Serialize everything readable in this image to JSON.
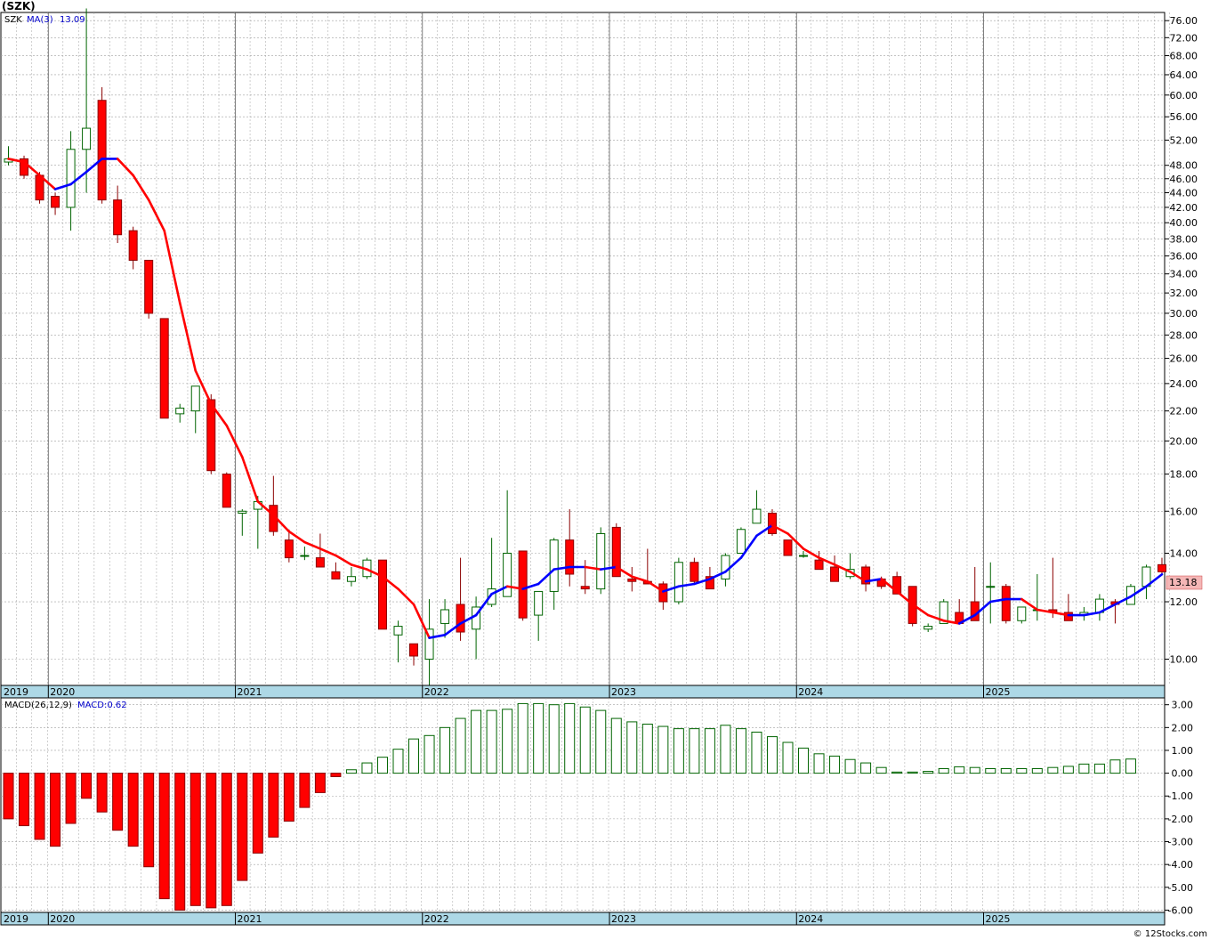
{
  "header": {
    "title": "(SZK)"
  },
  "price_panel": {
    "legend_symbol": "SZK",
    "legend_ma": "MA(3)",
    "legend_ma_value": "13.09",
    "current_price_label": "13.18"
  },
  "macd_panel": {
    "legend_name": "MACD(26,12,9)",
    "legend_value": "MACD:0.62"
  },
  "watermark": "© 12Stocks.com",
  "colors": {
    "up_fill": "#ffffff",
    "up_stroke": "#006400",
    "down_fill": "#ff0000",
    "down_stroke": "#8b0000",
    "ma_down": "#ff0000",
    "ma_up": "#0000ff",
    "axis_band": "#add8e6",
    "grid": "#a0a0a0",
    "price_tag_bg": "#f4b6b6"
  },
  "chart_data": [
    {
      "type": "candlestick",
      "scale": "log",
      "interval": "monthly",
      "ylim": [
        9.2,
        78
      ],
      "y_ticks": [
        "10.00",
        "12.00",
        "14.00",
        "16.00",
        "18.00",
        "20.00",
        "22.00",
        "24.00",
        "26.00",
        "28.00",
        "30.00",
        "32.00",
        "34.00",
        "36.00",
        "38.00",
        "40.00",
        "42.00",
        "44.00",
        "46.00",
        "48.00",
        "52.00",
        "56.00",
        "60.00",
        "64.00",
        "68.00",
        "72.00",
        "76.00"
      ],
      "x_labels": [
        "2019",
        "2020",
        "2021",
        "2022",
        "2023",
        "2024",
        "2025"
      ],
      "ohlc": [
        [
          48.5,
          51.0,
          48.0,
          49.0
        ],
        [
          49.0,
          49.5,
          46.0,
          46.5
        ],
        [
          46.5,
          47.0,
          42.5,
          43.0
        ],
        [
          43.5,
          44.0,
          41.0,
          42.0
        ],
        [
          42.0,
          53.5,
          39.0,
          50.5
        ],
        [
          50.5,
          79.0,
          44.0,
          54.0
        ],
        [
          59.0,
          61.5,
          42.5,
          43.0
        ],
        [
          43.0,
          45.0,
          37.5,
          38.5
        ],
        [
          39.0,
          39.5,
          34.5,
          35.5
        ],
        [
          35.5,
          35.5,
          29.5,
          30.0
        ],
        [
          29.5,
          29.5,
          21.5,
          21.5
        ],
        [
          21.8,
          22.5,
          21.2,
          22.2
        ],
        [
          22.0,
          23.8,
          20.5,
          23.8
        ],
        [
          22.8,
          23.2,
          18.0,
          18.2
        ],
        [
          18.0,
          18.1,
          16.2,
          16.2
        ],
        [
          15.9,
          16.1,
          14.8,
          16.0
        ],
        [
          16.1,
          16.8,
          14.2,
          16.5
        ],
        [
          16.3,
          17.9,
          14.8,
          15.0
        ],
        [
          14.6,
          15.1,
          13.6,
          13.8
        ],
        [
          13.9,
          14.3,
          13.7,
          13.9
        ],
        [
          13.8,
          14.9,
          13.4,
          13.4
        ],
        [
          13.2,
          13.6,
          12.9,
          12.9
        ],
        [
          12.8,
          13.4,
          12.6,
          13.0
        ],
        [
          13.0,
          13.8,
          12.9,
          13.7
        ],
        [
          13.7,
          13.7,
          11.0,
          11.0
        ],
        [
          10.8,
          11.3,
          9.9,
          11.1
        ],
        [
          10.5,
          10.5,
          9.8,
          10.1
        ],
        [
          10.0,
          12.1,
          9.2,
          11.0
        ],
        [
          11.2,
          12.1,
          10.7,
          11.7
        ],
        [
          11.9,
          13.8,
          10.6,
          10.9
        ],
        [
          11.0,
          12.2,
          10.0,
          11.8
        ],
        [
          11.9,
          14.7,
          11.8,
          12.5
        ],
        [
          12.2,
          17.1,
          12.2,
          14.0
        ],
        [
          14.1,
          14.1,
          11.3,
          11.4
        ],
        [
          11.5,
          12.4,
          10.6,
          12.4
        ],
        [
          12.4,
          14.7,
          11.7,
          14.6
        ],
        [
          14.6,
          16.1,
          12.6,
          13.1
        ],
        [
          12.6,
          13.7,
          12.3,
          12.5
        ],
        [
          12.5,
          15.2,
          12.3,
          14.9
        ],
        [
          15.2,
          15.4,
          13.0,
          13.0
        ],
        [
          12.9,
          13.4,
          12.4,
          12.8
        ],
        [
          12.8,
          14.2,
          12.7,
          12.7
        ],
        [
          12.7,
          12.8,
          11.7,
          12.0
        ],
        [
          12.0,
          13.8,
          11.9,
          13.6
        ],
        [
          13.6,
          13.8,
          12.7,
          12.8
        ],
        [
          13.0,
          13.4,
          12.5,
          12.5
        ],
        [
          12.9,
          14.0,
          12.6,
          13.9
        ],
        [
          14.0,
          15.2,
          14.0,
          15.1
        ],
        [
          15.4,
          17.1,
          15.4,
          16.1
        ],
        [
          15.9,
          16.1,
          14.8,
          14.9
        ],
        [
          14.6,
          14.6,
          13.9,
          13.9
        ],
        [
          13.9,
          14.1,
          13.8,
          13.9
        ],
        [
          13.7,
          14.1,
          13.4,
          13.3
        ],
        [
          13.4,
          13.9,
          12.8,
          12.8
        ],
        [
          13.0,
          14.0,
          12.9,
          13.3
        ],
        [
          13.4,
          13.5,
          12.4,
          12.7
        ],
        [
          12.9,
          13.0,
          12.5,
          12.6
        ],
        [
          13.0,
          13.2,
          12.3,
          12.3
        ],
        [
          12.6,
          12.6,
          11.1,
          11.2
        ],
        [
          11.0,
          11.2,
          10.9,
          11.1
        ],
        [
          11.2,
          12.1,
          11.2,
          12.0
        ],
        [
          11.6,
          12.1,
          11.2,
          11.2
        ],
        [
          12.0,
          13.4,
          11.3,
          11.3
        ],
        [
          12.6,
          13.6,
          11.2,
          12.6
        ],
        [
          12.6,
          12.7,
          11.2,
          11.3
        ],
        [
          11.3,
          11.8,
          11.2,
          11.8
        ],
        [
          11.7,
          13.1,
          11.3,
          11.7
        ],
        [
          11.7,
          13.8,
          11.4,
          11.6
        ],
        [
          11.6,
          12.3,
          11.4,
          11.3
        ],
        [
          11.5,
          11.8,
          11.3,
          11.6
        ],
        [
          11.6,
          12.3,
          11.3,
          12.1
        ],
        [
          12.0,
          12.1,
          11.2,
          11.9
        ],
        [
          11.9,
          12.7,
          11.9,
          12.6
        ],
        [
          12.6,
          13.5,
          12.1,
          13.4
        ],
        [
          13.5,
          13.8,
          13.1,
          13.2
        ]
      ],
      "ma3": [
        49.0,
        48.5,
        46.5,
        44.5,
        45.2,
        47.0,
        49.0,
        49.0,
        46.5,
        43.0,
        39.0,
        31.0,
        25.0,
        22.5,
        21.0,
        19.0,
        16.5,
        15.8,
        15.0,
        14.5,
        14.2,
        13.9,
        13.5,
        13.3,
        13.0,
        12.5,
        11.9,
        10.7,
        10.8,
        11.2,
        11.5,
        12.3,
        12.6,
        12.5,
        12.7,
        13.3,
        13.4,
        13.4,
        13.3,
        13.4,
        13.0,
        12.8,
        12.4,
        12.6,
        12.7,
        12.9,
        13.2,
        13.8,
        14.8,
        15.3,
        14.9,
        14.2,
        13.8,
        13.5,
        13.2,
        12.8,
        12.9,
        12.4,
        11.9,
        11.5,
        11.3,
        11.2,
        11.5,
        12.0,
        12.1,
        12.1,
        11.7,
        11.6,
        11.5,
        11.5,
        11.6,
        11.9,
        12.2,
        12.6,
        13.09
      ],
      "last_price": 13.18
    },
    {
      "type": "bar",
      "name": "MACD(26,12,9)",
      "ylim": [
        -6.1,
        3.3
      ],
      "y_ticks": [
        "3.00",
        "2.00",
        "1.00",
        "0.00",
        "-1.00",
        "-2.00",
        "-3.00",
        "-4.00",
        "-5.00",
        "-6.00"
      ],
      "x_labels": [
        "2019",
        "2020",
        "2021",
        "2022",
        "2023",
        "2024",
        "2025"
      ],
      "values": [
        -2.0,
        -2.3,
        -2.9,
        -3.2,
        -2.2,
        -1.1,
        -1.7,
        -2.5,
        -3.2,
        -4.1,
        -5.5,
        -6.0,
        -5.8,
        -5.9,
        -5.8,
        -4.7,
        -3.5,
        -2.8,
        -2.1,
        -1.5,
        -0.85,
        -0.15,
        0.15,
        0.45,
        0.7,
        1.05,
        1.5,
        1.65,
        2.0,
        2.4,
        2.75,
        2.75,
        2.8,
        3.05,
        3.05,
        3.0,
        3.05,
        2.9,
        2.75,
        2.4,
        2.25,
        2.15,
        2.05,
        1.95,
        1.95,
        1.95,
        2.1,
        1.95,
        1.8,
        1.6,
        1.35,
        1.1,
        0.85,
        0.75,
        0.6,
        0.45,
        0.25,
        0.05,
        0.05,
        0.08,
        0.2,
        0.28,
        0.25,
        0.2,
        0.2,
        0.2,
        0.2,
        0.25,
        0.3,
        0.4,
        0.4,
        0.58,
        0.62
      ]
    }
  ]
}
